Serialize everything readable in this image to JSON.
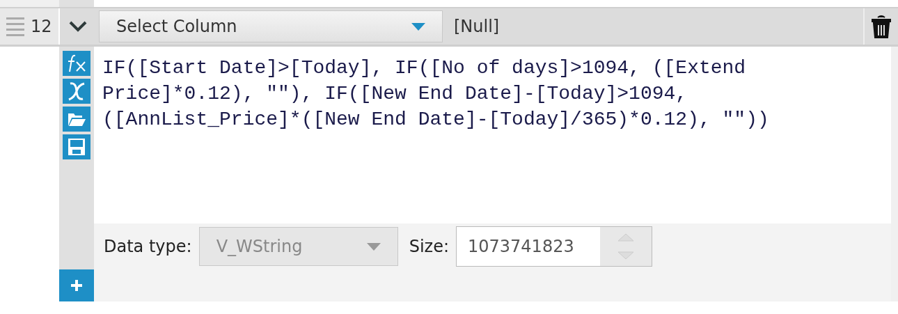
{
  "row": {
    "number": "12",
    "expanded": true,
    "column_select": {
      "value": "Select Column"
    },
    "original_value": "[Null]"
  },
  "formula": "IF([Start Date]>[Today], IF([No of days]>1094, ([Extend Price]*0.12), \"\"), IF([New End Date]-[Today]>1094, ([AnnList_Price]*([New End Date]-[Today]/365)*0.12), \"\"))",
  "data_type": {
    "label": "Data type:",
    "value": "V_WString",
    "disabled": true
  },
  "size": {
    "label": "Size:",
    "value": "1073741823"
  }
}
